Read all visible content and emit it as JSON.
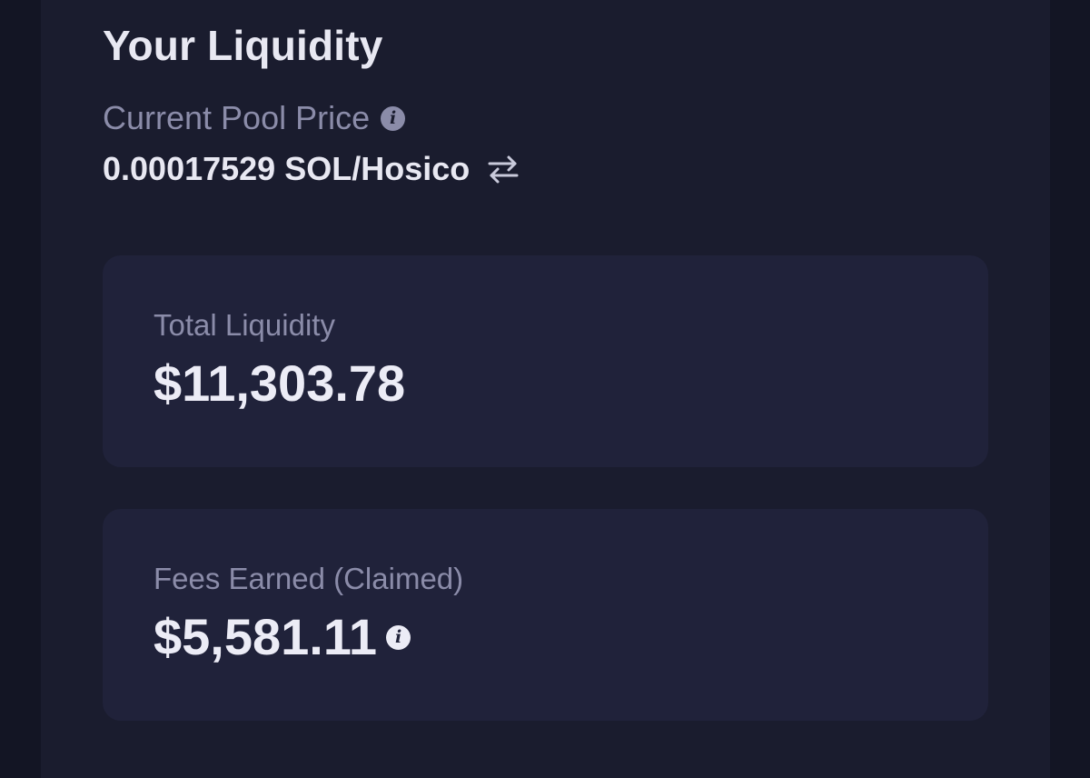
{
  "liquidity": {
    "title": "Your Liquidity",
    "pool_price": {
      "label": "Current Pool Price",
      "value": "0.00017529 SOL/Hosico",
      "info_icon": "info-icon",
      "swap_icon": "swap-arrows-icon"
    },
    "total_liquidity": {
      "label": "Total Liquidity",
      "value": "$11,303.78"
    },
    "fees_earned": {
      "label": "Fees Earned (Claimed)",
      "value": "$5,581.11",
      "info_icon": "info-icon"
    }
  },
  "colors": {
    "background": "#131524",
    "panel": "#1a1c2e",
    "card": "#20223a",
    "text_primary": "#e8e8f2",
    "text_muted": "#8b8ca9"
  }
}
